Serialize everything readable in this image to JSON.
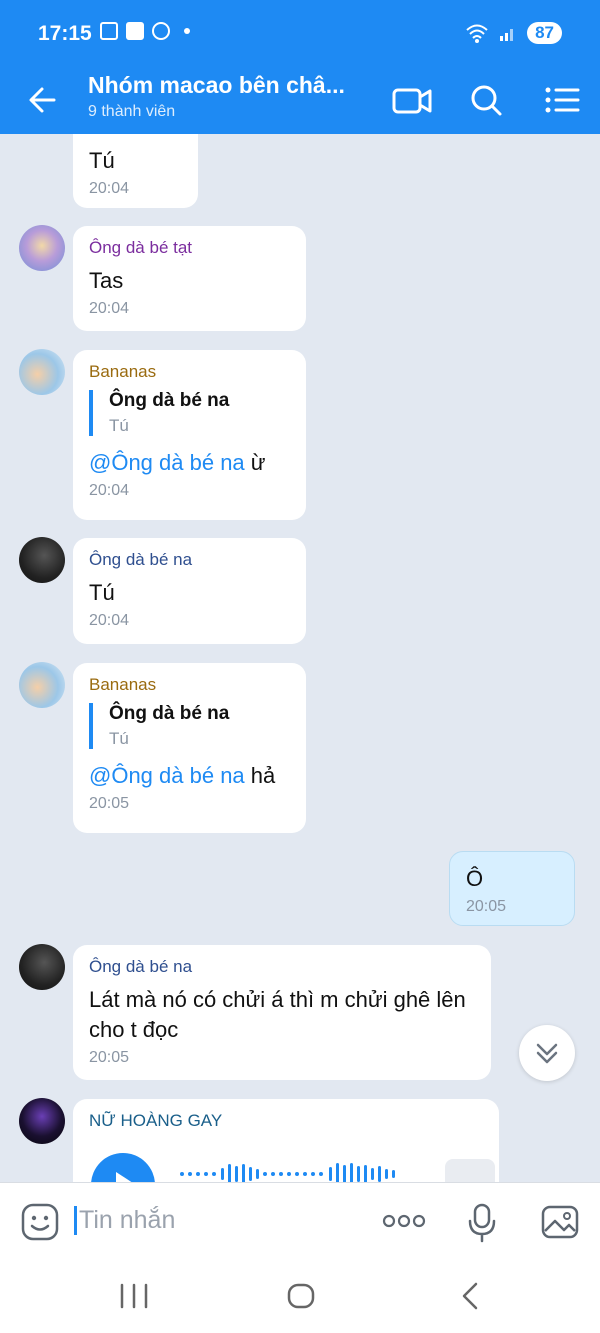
{
  "status": {
    "time": "17:15",
    "battery": "87"
  },
  "header": {
    "title": "Nhóm macao bên châ...",
    "subtitle": "9 thành viên"
  },
  "messages": [
    {
      "text": "Tú",
      "time": "20:04"
    },
    {
      "sender": "Ông dà bé tạt",
      "text": "Tas",
      "time": "20:04"
    },
    {
      "sender": "Bananas",
      "quote_name": "Ông dà bé na",
      "quote_text": "Tú",
      "mention": "@Ông dà bé na",
      "text": " ừ",
      "time": "20:04"
    },
    {
      "sender": "Ông dà bé na",
      "text": "Tú",
      "time": "20:04"
    },
    {
      "sender": "Bananas",
      "quote_name": "Ông dà bé na",
      "quote_text": "Tú",
      "mention": "@Ông dà bé na",
      "text": " hả",
      "time": "20:05"
    },
    {
      "text": "Ô",
      "time": "20:05"
    },
    {
      "sender": "Ông dà bé na",
      "text": "Lát mà nó có chửi á thì m chửi ghê lên cho t đọc",
      "time": "20:05"
    },
    {
      "sender": "NỮ HOÀNG GAY"
    }
  ],
  "input": {
    "placeholder": "Tin nhắn"
  },
  "colors": {
    "accent": "#1e8af3",
    "purple_name": "#7b2d9e",
    "gold_name": "#9a6b10",
    "navy_name": "#2f4f8f",
    "teal_name": "#1a5f8a"
  },
  "icons": [
    "back-arrow-icon",
    "video-call-icon",
    "search-icon",
    "menu-icon",
    "emoji-icon",
    "more-icon",
    "mic-icon",
    "image-icon",
    "chevron-down-icon",
    "play-icon"
  ]
}
